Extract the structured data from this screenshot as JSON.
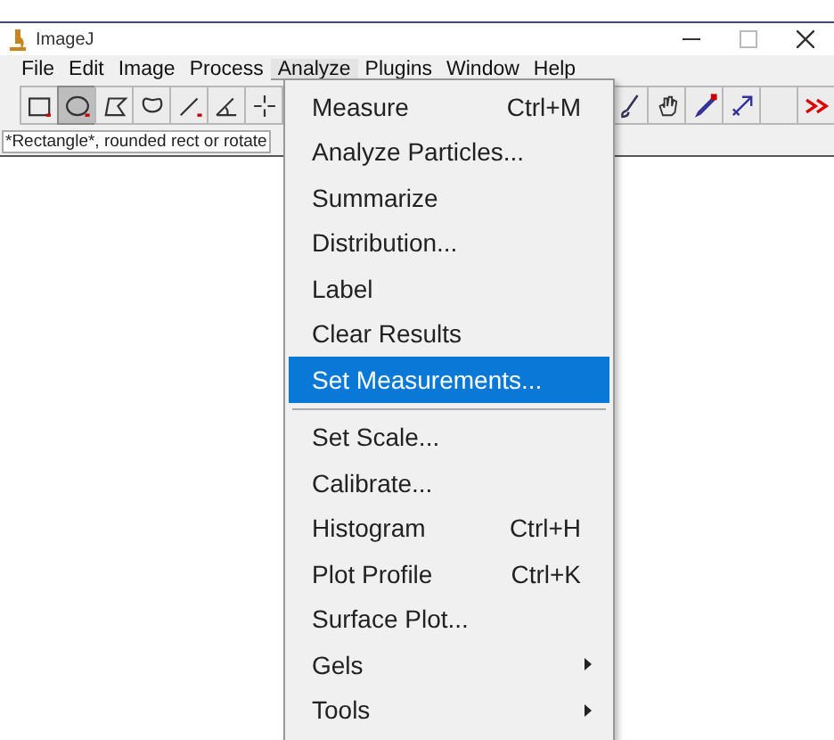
{
  "window": {
    "title": "ImageJ"
  },
  "menubar": [
    {
      "label": "File",
      "selected": false
    },
    {
      "label": "Edit",
      "selected": false
    },
    {
      "label": "Image",
      "selected": false
    },
    {
      "label": "Process",
      "selected": false
    },
    {
      "label": "Analyze",
      "selected": true
    },
    {
      "label": "Plugins",
      "selected": false
    },
    {
      "label": "Window",
      "selected": false
    },
    {
      "label": "Help",
      "selected": false
    }
  ],
  "toolbar": {
    "left": [
      {
        "kind": "rect",
        "selected": false
      },
      {
        "kind": "oval",
        "selected": true
      },
      {
        "kind": "polygon",
        "selected": false
      },
      {
        "kind": "freehand",
        "selected": false
      },
      {
        "kind": "line",
        "selected": false
      },
      {
        "kind": "angle",
        "selected": false
      },
      {
        "kind": "point",
        "selected": false
      }
    ],
    "right": [
      {
        "kind": "brush",
        "selected": false
      },
      {
        "kind": "hand",
        "selected": false
      },
      {
        "kind": "dropper",
        "selected": false
      },
      {
        "kind": "arrowtool",
        "selected": false
      },
      {
        "kind": "empty",
        "selected": false
      },
      {
        "kind": "more",
        "selected": false
      }
    ]
  },
  "status_bar": "*Rectangle*, rounded rect or rotate",
  "menu": {
    "groups": [
      [
        {
          "label": "Measure",
          "shortcut": "Ctrl+M",
          "selected": false,
          "submenu": false
        },
        {
          "label": "Analyze Particles...",
          "selected": false,
          "submenu": false
        },
        {
          "label": "Summarize",
          "selected": false,
          "submenu": false
        },
        {
          "label": "Distribution...",
          "selected": false,
          "submenu": false
        },
        {
          "label": "Label",
          "selected": false,
          "submenu": false
        },
        {
          "label": "Clear Results",
          "selected": false,
          "submenu": false
        },
        {
          "label": "Set Measurements...",
          "selected": true,
          "submenu": false
        }
      ],
      [
        {
          "label": "Set Scale...",
          "selected": false,
          "submenu": false
        },
        {
          "label": "Calibrate...",
          "selected": false,
          "submenu": false
        },
        {
          "label": "Histogram",
          "shortcut": "Ctrl+H",
          "selected": false,
          "submenu": false
        },
        {
          "label": "Plot Profile",
          "shortcut": "Ctrl+K",
          "selected": false,
          "submenu": false
        },
        {
          "label": "Surface Plot...",
          "selected": false,
          "submenu": false
        },
        {
          "label": "Gels",
          "selected": false,
          "submenu": true
        },
        {
          "label": "Tools",
          "selected": false,
          "submenu": true
        }
      ]
    ]
  }
}
